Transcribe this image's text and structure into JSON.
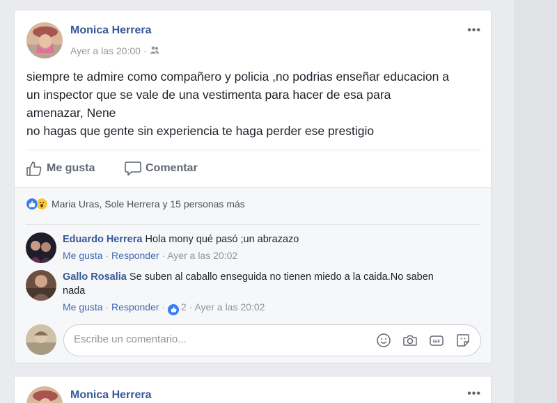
{
  "post": {
    "author": "Monica Herrera",
    "timestamp": "Ayer a las 20:00",
    "separator": "·",
    "audience_icon": "friends-icon",
    "more_label": "•••",
    "text_lines": [
      "siempre te admire como compañero y policia ,no podrias enseñar educacion a",
      "un inspector que se vale de una vestimenta para hacer de esa para",
      "amenazar, Nene",
      "no hagas que gente sin experiencia te haga perder ese prestigio"
    ],
    "actions": {
      "like": "Me gusta",
      "comment": "Comentar"
    },
    "reactions_summary": "Maria Uras, Sole Herrera y 15 personas más"
  },
  "comments": [
    {
      "author": "Eduardo Herrera",
      "text": "Hola mony qué pasó ;un abrazazo",
      "like": "Me gusta",
      "reply": "Responder",
      "time": "Ayer a las 20:02"
    },
    {
      "author": "Gallo Rosalia",
      "text": "Se suben al caballo enseguida no tienen miedo a la caida.No saben nada",
      "like": "Me gusta",
      "reply": "Responder",
      "like_count": "2",
      "time": "Ayer a las 20:02"
    }
  ],
  "composer": {
    "placeholder": "Escribe un comentario...",
    "icons": [
      "emoji-icon",
      "camera-icon",
      "gif-icon",
      "sticker-icon"
    ]
  },
  "next_post": {
    "author": "Monica Herrera",
    "more_label": "•••"
  },
  "colors": {
    "link_blue": "#365899",
    "like_blue": "#3b7cf0",
    "wow_yellow": "#f7c43b",
    "page_bg": "#e9ebee"
  }
}
